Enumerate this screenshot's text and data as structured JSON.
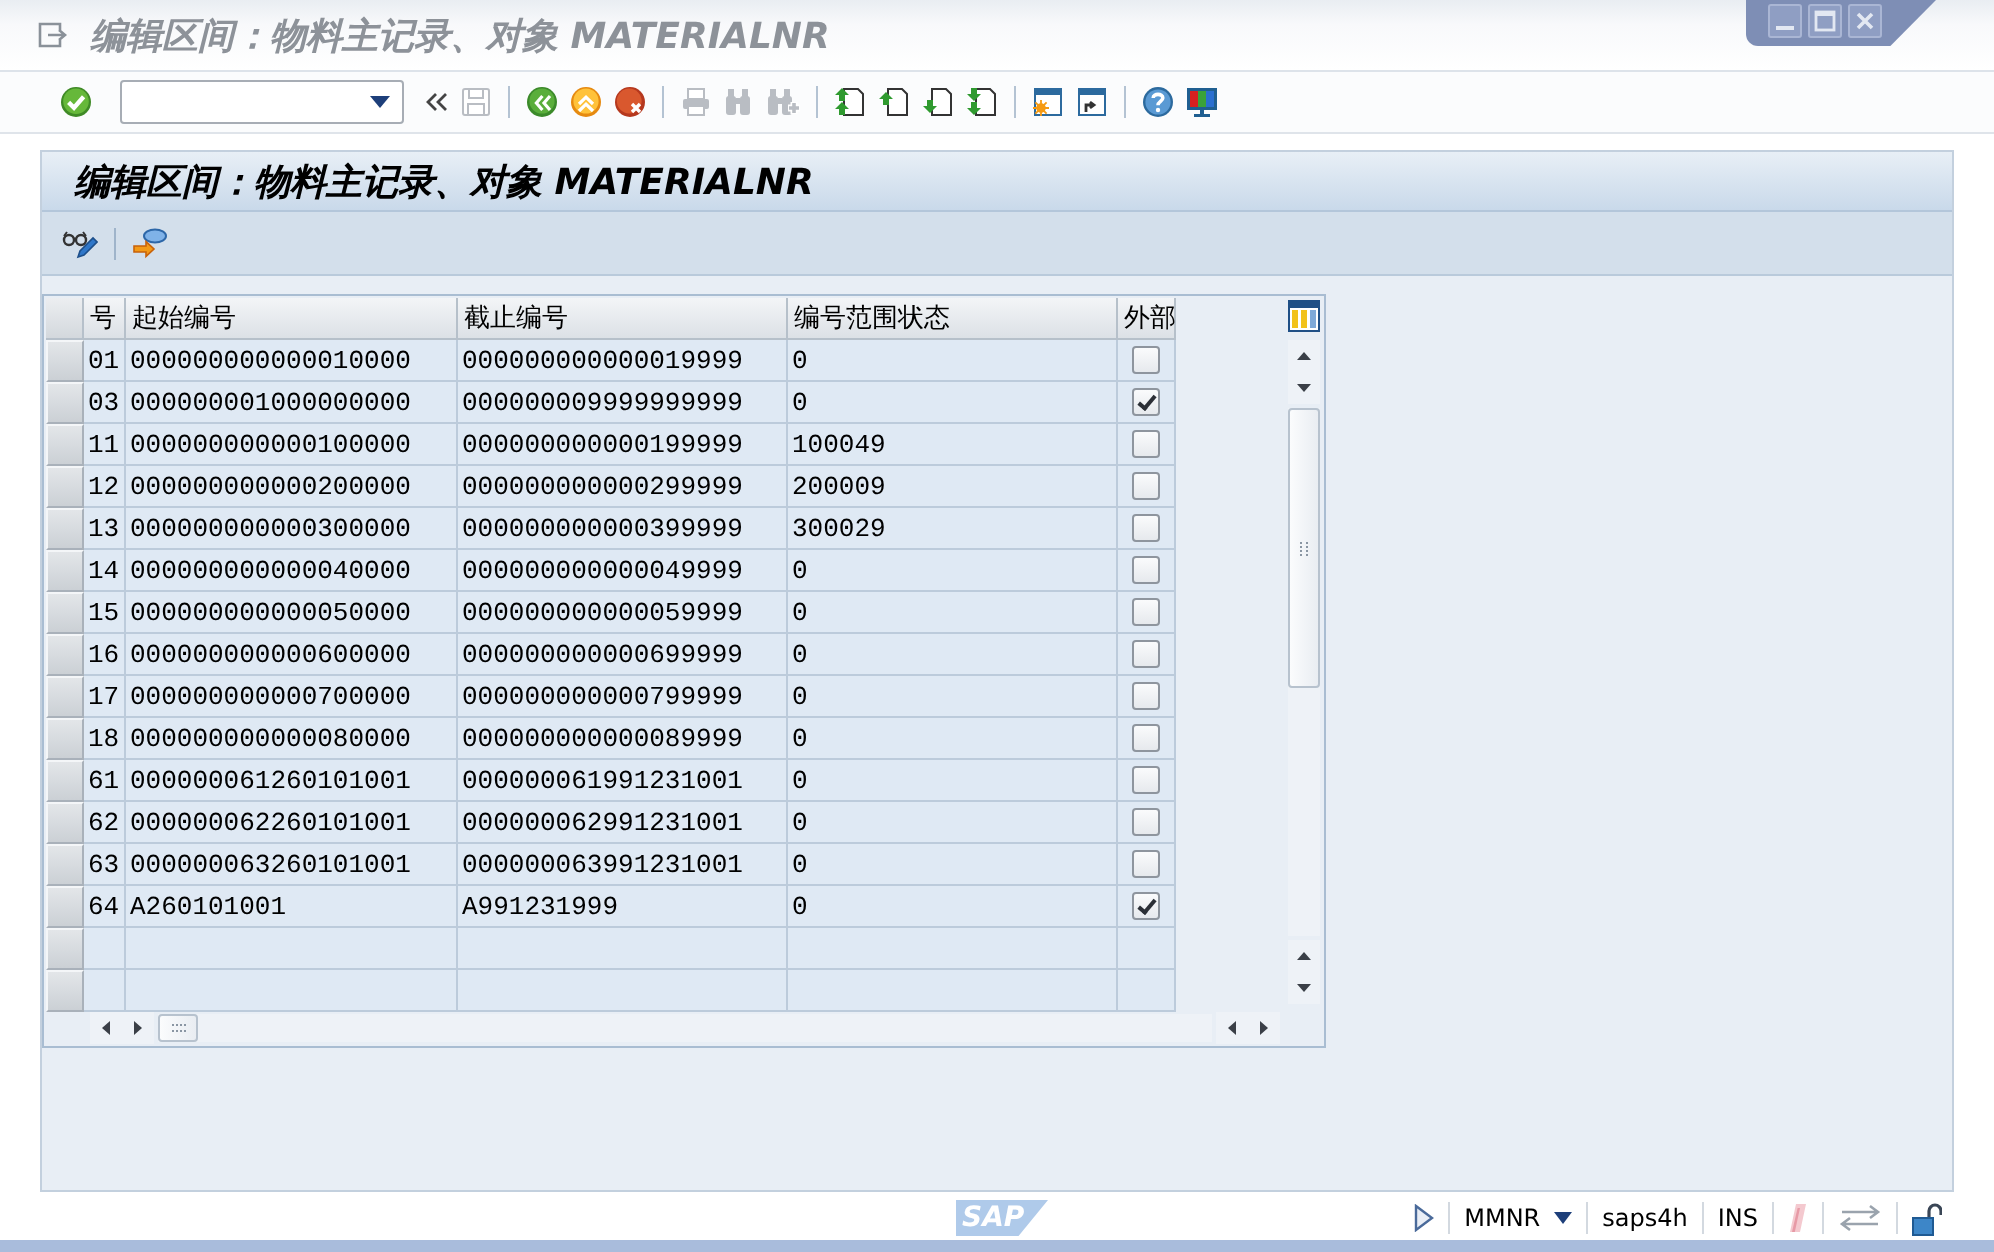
{
  "window": {
    "title": "编辑区间：物料主记录、对象 MATERIALNR"
  },
  "toolbar": {
    "groups": [
      {
        "buttons": [
          {
            "kind": "enter",
            "disabled": false
          },
          {
            "kind": "command_field",
            "disabled": false
          },
          {
            "kind": "collapse",
            "disabled": false
          },
          {
            "kind": "save",
            "disabled": true
          }
        ]
      },
      {
        "buttons": [
          {
            "kind": "back",
            "disabled": false
          },
          {
            "kind": "exit",
            "disabled": false
          },
          {
            "kind": "cancel",
            "disabled": false
          }
        ]
      },
      {
        "buttons": [
          {
            "kind": "print",
            "disabled": true
          },
          {
            "kind": "find",
            "disabled": true
          },
          {
            "kind": "find_next",
            "disabled": true
          }
        ]
      },
      {
        "buttons": [
          {
            "kind": "first_page",
            "disabled": false
          },
          {
            "kind": "previous_page",
            "disabled": false
          },
          {
            "kind": "next_page",
            "disabled": false
          },
          {
            "kind": "last_page",
            "disabled": false
          }
        ]
      },
      {
        "buttons": [
          {
            "kind": "create_session",
            "disabled": false
          },
          {
            "kind": "shortcut",
            "disabled": false
          }
        ]
      },
      {
        "buttons": [
          {
            "kind": "help",
            "disabled": false
          },
          {
            "kind": "layout",
            "disabled": false
          }
        ]
      }
    ]
  },
  "screen": {
    "title": "编辑区间：物料主记录、对象 MATERIALNR",
    "app_toolbar": {
      "buttons": [
        {
          "kind": "display_change"
        },
        {
          "kind": "status"
        }
      ]
    }
  },
  "table": {
    "columns": [
      "号",
      "起始编号",
      "截止编号",
      "编号范围状态",
      "外部"
    ],
    "rows": [
      {
        "selected": false,
        "cells": [
          "01",
          "000000000000010000",
          "000000000000019999",
          "0"
        ],
        "external": false
      },
      {
        "selected": false,
        "cells": [
          "03",
          "000000001000000000",
          "000000009999999999",
          "0"
        ],
        "external": true
      },
      {
        "selected": false,
        "cells": [
          "11",
          "000000000000100000",
          "000000000000199999",
          "100049"
        ],
        "external": false
      },
      {
        "selected": false,
        "cells": [
          "12",
          "000000000000200000",
          "000000000000299999",
          "200009"
        ],
        "external": false
      },
      {
        "selected": false,
        "cells": [
          "13",
          "000000000000300000",
          "000000000000399999",
          "300029"
        ],
        "external": false
      },
      {
        "selected": false,
        "cells": [
          "14",
          "000000000000040000",
          "000000000000049999",
          "0"
        ],
        "external": false
      },
      {
        "selected": false,
        "cells": [
          "15",
          "000000000000050000",
          "000000000000059999",
          "0"
        ],
        "external": false
      },
      {
        "selected": false,
        "cells": [
          "16",
          "000000000000600000",
          "000000000000699999",
          "0"
        ],
        "external": false
      },
      {
        "selected": false,
        "cells": [
          "17",
          "000000000000700000",
          "000000000000799999",
          "0"
        ],
        "external": false
      },
      {
        "selected": false,
        "cells": [
          "18",
          "000000000000080000",
          "000000000000089999",
          "0"
        ],
        "external": false
      },
      {
        "selected": false,
        "cells": [
          "61",
          "000000061260101001",
          "000000061991231001",
          "0"
        ],
        "external": false
      },
      {
        "selected": false,
        "cells": [
          "62",
          "000000062260101001",
          "000000062991231001",
          "0"
        ],
        "external": false
      },
      {
        "selected": false,
        "cells": [
          "63",
          "000000063260101001",
          "000000063991231001",
          "0"
        ],
        "external": false
      },
      {
        "selected": false,
        "cells": [
          "64",
          "A260101001",
          "A991231999",
          "0"
        ],
        "external": true
      }
    ]
  },
  "status_bar": {
    "logo": "SAP",
    "system": "MMNR",
    "server": "saps4h",
    "mode": "INS"
  }
}
